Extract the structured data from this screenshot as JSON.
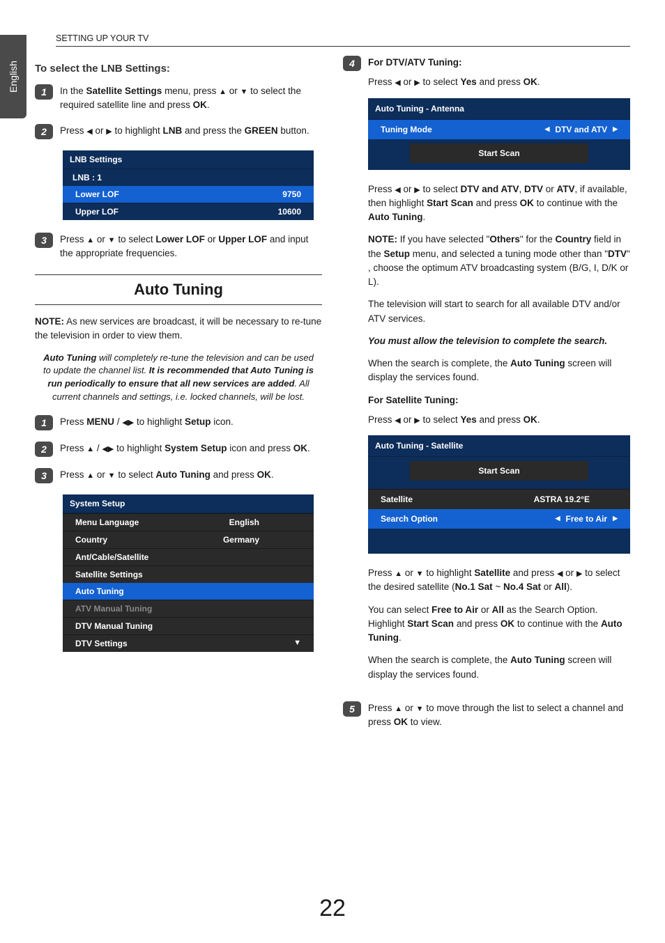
{
  "header": {
    "section_title": "SETTING UP YOUR TV",
    "lang_tab": "English"
  },
  "lnb_section": {
    "heading": "To select the LNB Settings:",
    "step1_pre": "In the ",
    "step1_b1": "Satellite Settings",
    "step1_mid": " menu, press ",
    "step1_post": " to select the required satellite line and press ",
    "step1_ok": "OK",
    "step1_end": ".",
    "step2_pre": "Press ",
    "step2_mid": " to highlight ",
    "step2_lnb": "LNB",
    "step2_mid2": " and press the ",
    "step2_green": "GREEN",
    "step2_end": " button.",
    "panel": {
      "title": "LNB Settings",
      "sub": "LNB : 1",
      "row1_label": "Lower LOF",
      "row1_val": "9750",
      "row2_label": "Upper LOF",
      "row2_val": "10600"
    },
    "step3_pre": "Press ",
    "step3_mid": " to select ",
    "step3_b1": "Lower LOF",
    "step3_or": " or ",
    "step3_b2": "Upper LOF",
    "step3_end": " and input the appropriate frequencies."
  },
  "auto_tuning": {
    "title": "Auto Tuning",
    "note_label": "NOTE:",
    "note_text": " As new services are broadcast, it will be necessary to re-tune the television in order to view them.",
    "center_b1": "Auto Tuning",
    "center_t1": " will completely re-tune the television and can be used to update the channel list. ",
    "center_b2": "It is recommended that Auto Tuning is run periodically to ensure that all new services are added",
    "center_t2": ". All current channels and settings, i.e. locked channels, will be lost.",
    "s1_pre": "Press ",
    "s1_menu": "MENU",
    "s1_mid": " / ",
    "s1_post": " to highlight ",
    "s1_setup": "Setup",
    "s1_end": " icon.",
    "s2_pre": "Press ",
    "s2_mid": " / ",
    "s2_post": " to highlight ",
    "s2_sys": "System Setup",
    "s2_end": " icon and press ",
    "s2_ok": "OK",
    "s2_dot": ".",
    "s3_pre": "Press ",
    "s3_mid": " to select ",
    "s3_at": "Auto Tuning",
    "s3_end": " and press ",
    "s3_ok": "OK",
    "s3_dot": ".",
    "syspanel": {
      "title": "System Setup",
      "r1l": "Menu Language",
      "r1v": "English",
      "r2l": "Country",
      "r2v": "Germany",
      "r3l": "Ant/Cable/Satellite",
      "r4l": "Satellite Settings",
      "r5l": "Auto Tuning",
      "r6l": "ATV Manual Tuning",
      "r7l": "DTV Manual Tuning",
      "r8l": "DTV Settings"
    }
  },
  "right": {
    "dtv_heading": "For DTV/ATV Tuning:",
    "dtv_line_pre": "Press ",
    "dtv_line_mid": " to select ",
    "dtv_yes": "Yes",
    "dtv_line_mid2": " and press ",
    "dtv_ok": "OK",
    "dtv_dot": ".",
    "ant_panel": {
      "title": "Auto Tuning - Antenna",
      "tm_label": "Tuning Mode",
      "tm_val": "DTV and ATV",
      "scan": "Start Scan"
    },
    "p2_pre": "Press ",
    "p2_mid": " to select ",
    "p2_b1": "DTV and ATV",
    "p2_c1": ", ",
    "p2_b2": "DTV",
    "p2_or": " or ",
    "p2_b3": "ATV",
    "p2_mid2": ", if available, then highlight ",
    "p2_ss": "Start Scan",
    "p2_mid3": " and press ",
    "p2_ok": "OK",
    "p2_mid4": " to continue with the ",
    "p2_at": "Auto Tuning",
    "p2_dot": ".",
    "note_label": "NOTE:",
    "note_t1": " If you have selected \"",
    "note_b1": "Others",
    "note_t2": "\" for the ",
    "note_b2": "Country",
    "note_t3": " field in the ",
    "note_b3": "Setup",
    "note_t4": " menu, and selected a tuning mode other than \"",
    "note_b4": "DTV",
    "note_t5": "\" , choose the optimum ATV broadcasting system (B/G, I, D/K or L).",
    "p3": "The television will start to search for all available DTV and/or ATV services.",
    "p4": "You must allow the television to complete the search.",
    "p5_pre": "When the search is complete, the ",
    "p5_b": "Auto Tuning",
    "p5_post": " screen will display the services found.",
    "sat_heading": "For Satellite Tuning:",
    "sat_line_pre": "Press ",
    "sat_line_mid": " to select ",
    "sat_yes": "Yes",
    "sat_line_mid2": " and press ",
    "sat_ok": "OK",
    "sat_dot": ".",
    "sat_panel": {
      "title": "Auto Tuning - Satellite",
      "scan": "Start Scan",
      "r1l": "Satellite",
      "r1v": "ASTRA 19.2°E",
      "r2l": "Search Option",
      "r2v": "Free to Air"
    },
    "sp1_pre": "Press ",
    "sp1_mid": " to highlight ",
    "sp1_b1": "Satellite",
    "sp1_mid2": " and press ",
    "sp1_mid3": " to select the desired satellite (",
    "sp1_b2": "No.1 Sat",
    "sp1_tilde": " ~ ",
    "sp1_b3": "No.4 Sat",
    "sp1_or": " or ",
    "sp1_b4": "All",
    "sp1_end": ").",
    "sp2_pre": "You can select ",
    "sp2_b1": "Free to Air",
    "sp2_or": " or ",
    "sp2_b2": "All",
    "sp2_mid": " as the Search Option. Highlight ",
    "sp2_b3": "Start Scan",
    "sp2_mid2": " and press ",
    "sp2_ok": "OK",
    "sp2_mid3": " to continue with the ",
    "sp2_at": "Auto Tuning",
    "sp2_dot": ".",
    "sp3_pre": "When the search is complete, the ",
    "sp3_b": "Auto Tuning",
    "sp3_post": " screen will display the services found.",
    "s5_pre": "Press ",
    "s5_mid": " to move through the list to select a channel and press ",
    "s5_ok": "OK",
    "s5_end": " to view."
  },
  "glyphs": {
    "up": "▲",
    "down": "▼",
    "left": "◀",
    "right": "▶",
    "or": " or ",
    "updown": "▲ or ▼",
    "leftright": "◀ or ▶",
    "lr_tight": "◀▶"
  },
  "page_number": "22"
}
